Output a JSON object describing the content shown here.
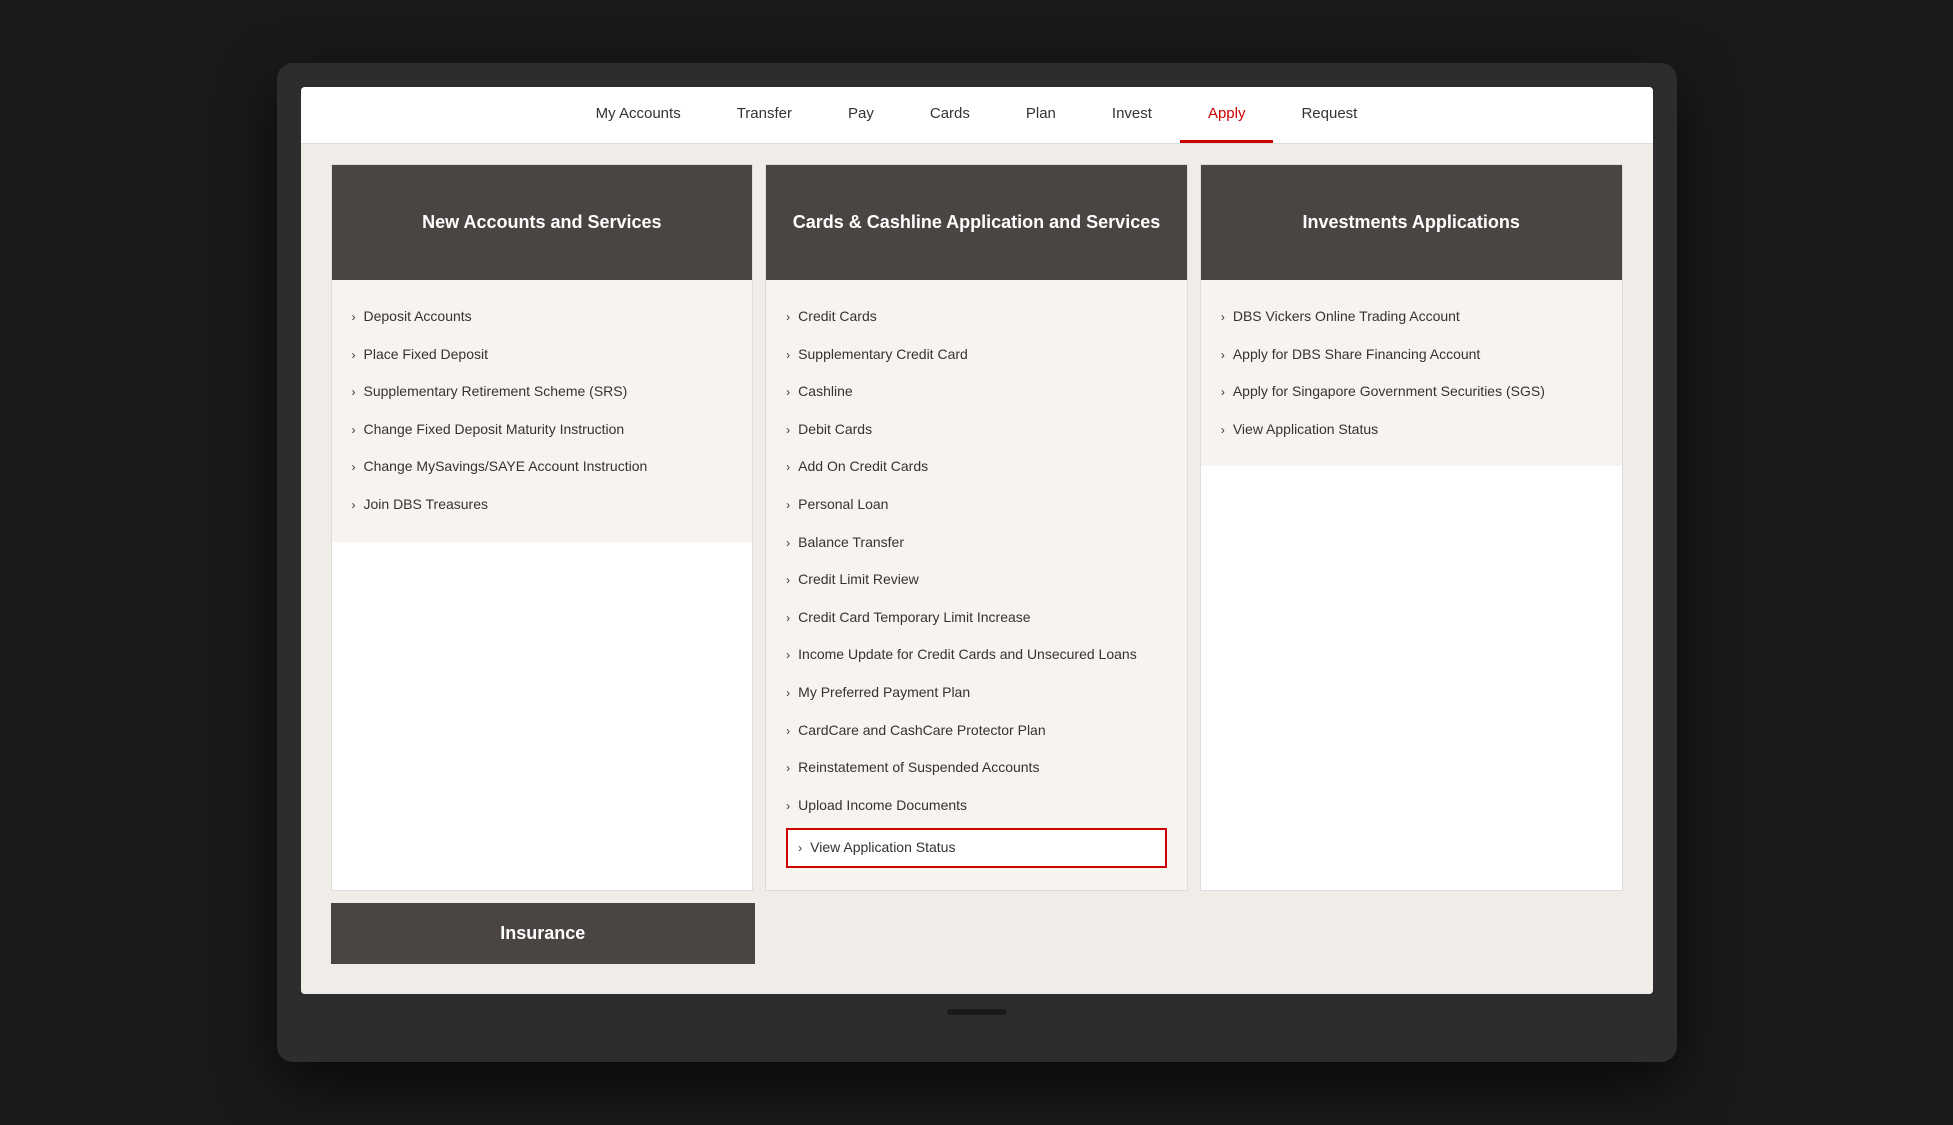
{
  "nav": {
    "items": [
      {
        "label": "My Accounts",
        "active": false
      },
      {
        "label": "Transfer",
        "active": false
      },
      {
        "label": "Pay",
        "active": false
      },
      {
        "label": "Cards",
        "active": false
      },
      {
        "label": "Plan",
        "active": false
      },
      {
        "label": "Invest",
        "active": false
      },
      {
        "label": "Apply",
        "active": true
      },
      {
        "label": "Request",
        "active": false
      }
    ]
  },
  "columns": [
    {
      "id": "new-accounts",
      "header": "New Accounts and Services",
      "items": [
        {
          "label": "Deposit Accounts"
        },
        {
          "label": "Place Fixed Deposit"
        },
        {
          "label": "Supplementary Retirement Scheme (SRS)"
        },
        {
          "label": "Change Fixed Deposit Maturity Instruction"
        },
        {
          "label": "Change MySavings/SAYE Account Instruction"
        },
        {
          "label": "Join DBS Treasures"
        }
      ]
    },
    {
      "id": "cards-cashline",
      "header": "Cards & Cashline Application and Services",
      "items": [
        {
          "label": "Credit Cards",
          "highlighted": false
        },
        {
          "label": "Supplementary Credit Card",
          "highlighted": false
        },
        {
          "label": "Cashline",
          "highlighted": false
        },
        {
          "label": "Debit Cards",
          "highlighted": false
        },
        {
          "label": "Add On Credit Cards",
          "highlighted": false
        },
        {
          "label": "Personal Loan",
          "highlighted": false
        },
        {
          "label": "Balance Transfer",
          "highlighted": false
        },
        {
          "label": "Credit Limit Review",
          "highlighted": false
        },
        {
          "label": "Credit Card Temporary Limit Increase",
          "highlighted": false
        },
        {
          "label": "Income Update for Credit Cards and Unsecured Loans",
          "highlighted": false
        },
        {
          "label": "My Preferred Payment Plan",
          "highlighted": false
        },
        {
          "label": "CardCare and CashCare Protector Plan",
          "highlighted": false
        },
        {
          "label": "Reinstatement of Suspended Accounts",
          "highlighted": false
        },
        {
          "label": "Upload Income Documents",
          "highlighted": false
        },
        {
          "label": "View Application Status",
          "highlighted": true
        }
      ]
    },
    {
      "id": "investments",
      "header": "Investments Applications",
      "items": [
        {
          "label": "DBS Vickers Online Trading Account"
        },
        {
          "label": "Apply for DBS Share Financing Account"
        },
        {
          "label": "Apply for Singapore Government Securities (SGS)"
        },
        {
          "label": "View Application Status"
        }
      ]
    }
  ],
  "bottom": {
    "insurance_label": "Insurance"
  }
}
